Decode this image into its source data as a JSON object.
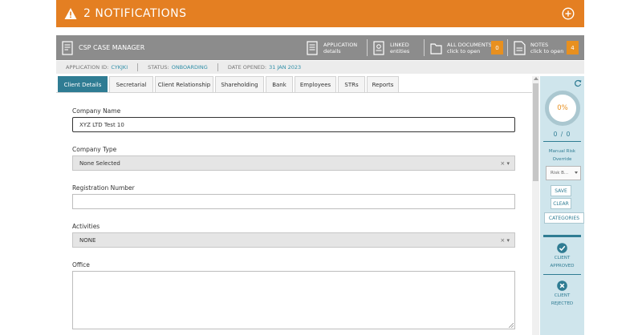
{
  "notifications": {
    "title": "2 NOTIFICATIONS"
  },
  "case_bar": {
    "title": "CSP CASE MANAGER",
    "application": {
      "line1": "APPLICATION",
      "line2": "details"
    },
    "linked": {
      "line1": "LINKED",
      "line2": "entities"
    },
    "all_documents": {
      "line1": "ALL DOCUMENTS",
      "line2": "click to open",
      "count": "0"
    },
    "notes": {
      "line1": "NOTES",
      "line2": "click to open",
      "count": "4"
    }
  },
  "info": {
    "application_id_label": "APPLICATION ID:",
    "application_id": "CYKJKI",
    "status_label": "STATUS:",
    "status": "ONBOARDING",
    "date_label": "DATE OPENED:",
    "date": "31 JAN 2023"
  },
  "tabs": [
    "Client Details",
    "Secretarial",
    "Client Relationship",
    "Shareholding",
    "Bank",
    "Employees",
    "STRs",
    "Reports"
  ],
  "form": {
    "company_name_label": "Company Name",
    "company_name_value": "XYZ LTD Test 10",
    "company_type_label": "Company Type",
    "company_type_value": "None Selected",
    "registration_label": "Registration Number",
    "registration_value": "",
    "activities_label": "Activities",
    "activities_value": "NONE",
    "office_label": "Office",
    "clear_symbol": "×",
    "dropdown_symbol": "▾"
  },
  "panel": {
    "percent": "0%",
    "ratio": "0 / 0",
    "manual_risk_line1": "Manual Risk",
    "manual_risk_line2": "Override",
    "risk_select": "Risk B...",
    "save": "SAVE",
    "clear": "CLEAR",
    "categories": "CATEGORIES",
    "approved_line1": "CLIENT",
    "approved_line2": "APPROVED",
    "rejected_line1": "CLIENT",
    "rejected_line2": "REJECTED"
  },
  "colors": {
    "notification_orange": "#e47f22",
    "teal": "#2f7c93",
    "badge_orange": "#e8901f",
    "panel_blue": "#cfe5ec"
  }
}
